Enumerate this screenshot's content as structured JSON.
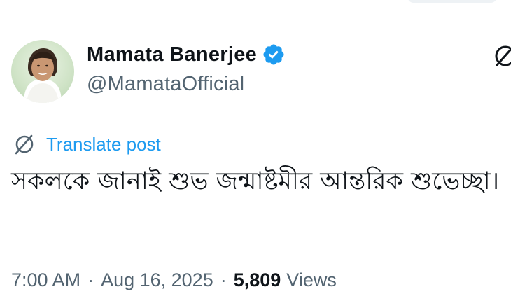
{
  "post": {
    "author": {
      "display_name": "Mamata Banerjee",
      "handle": "@MamataOfficial",
      "verified": true
    },
    "translate_label": "Translate post",
    "text": "সকলকে জানাই শুভ জন্মাষ্টমীর আন্তরিক শুভেচ্ছা।",
    "meta": {
      "time": "7:00 AM",
      "separator": "·",
      "date": "Aug 16, 2025",
      "views_count": "5,809",
      "views_label": "Views"
    }
  },
  "colors": {
    "accent": "#1d9bf0",
    "text_primary": "#0f1419",
    "text_secondary": "#536471"
  },
  "icons": {
    "verified": "verified-badge-icon",
    "grok": "grok-icon",
    "translate": "translate-icon"
  }
}
